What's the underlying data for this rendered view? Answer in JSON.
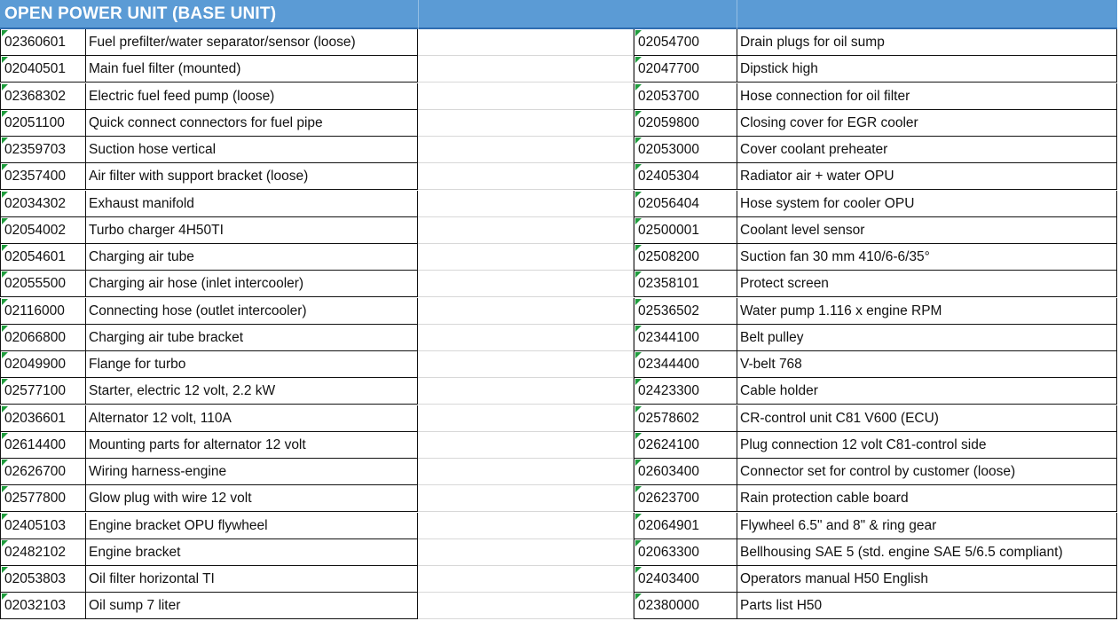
{
  "header": {
    "title": "OPEN POWER UNIT (BASE UNIT)"
  },
  "colors": {
    "header_bg": "#5b9bd5",
    "header_text": "#ffffff",
    "marker": "#1e9c3c"
  },
  "left_rows": [
    {
      "code": "02360601",
      "desc": "Fuel prefilter/water separator/sensor (loose)"
    },
    {
      "code": "02040501",
      "desc": "Main fuel filter (mounted)"
    },
    {
      "code": "02368302",
      "desc": "Electric fuel feed pump (loose)"
    },
    {
      "code": "02051100",
      "desc": "Quick connect connectors for fuel pipe"
    },
    {
      "code": "02359703",
      "desc": "Suction hose vertical"
    },
    {
      "code": "02357400",
      "desc": "Air filter with support bracket (loose)"
    },
    {
      "code": "02034302",
      "desc": "Exhaust manifold"
    },
    {
      "code": "02054002",
      "desc": "Turbo charger 4H50TI"
    },
    {
      "code": "02054601",
      "desc": "Charging air tube"
    },
    {
      "code": "02055500",
      "desc": "Charging air hose (inlet intercooler)"
    },
    {
      "code": "02116000",
      "desc": "Connecting hose (outlet intercooler)"
    },
    {
      "code": "02066800",
      "desc": "Charging air tube bracket"
    },
    {
      "code": "02049900",
      "desc": "Flange for turbo"
    },
    {
      "code": "02577100",
      "desc": "Starter, electric 12 volt, 2.2 kW"
    },
    {
      "code": "02036601",
      "desc": "Alternator 12 volt, 110A"
    },
    {
      "code": "02614400",
      "desc": "Mounting parts for alternator 12 volt"
    },
    {
      "code": "02626700",
      "desc": "Wiring harness-engine"
    },
    {
      "code": "02577800",
      "desc": "Glow plug with wire 12 volt"
    },
    {
      "code": "02405103",
      "desc": "Engine bracket OPU flywheel"
    },
    {
      "code": "02482102",
      "desc": "Engine bracket"
    },
    {
      "code": "02053803",
      "desc": "Oil filter horizontal TI"
    },
    {
      "code": "02032103",
      "desc": "Oil sump 7 liter"
    }
  ],
  "right_rows": [
    {
      "code": "02054700",
      "desc": "Drain plugs for oil sump"
    },
    {
      "code": "02047700",
      "desc": "Dipstick high"
    },
    {
      "code": "02053700",
      "desc": "Hose connection for oil filter"
    },
    {
      "code": "02059800",
      "desc": "Closing cover for EGR cooler"
    },
    {
      "code": "02053000",
      "desc": "Cover coolant preheater"
    },
    {
      "code": "02405304",
      "desc": "Radiator air + water OPU"
    },
    {
      "code": "02056404",
      "desc": "Hose system for cooler OPU"
    },
    {
      "code": "02500001",
      "desc": "Coolant level sensor"
    },
    {
      "code": "02508200",
      "desc": "Suction fan 30 mm 410/6-6/35°"
    },
    {
      "code": "02358101",
      "desc": "Protect screen"
    },
    {
      "code": "02536502",
      "desc": "Water pump 1.116 x engine RPM"
    },
    {
      "code": "02344100",
      "desc": "Belt pulley"
    },
    {
      "code": "02344400",
      "desc": "V-belt 768"
    },
    {
      "code": "02423300",
      "desc": "Cable holder"
    },
    {
      "code": "02578602",
      "desc": "CR-control unit C81 V600 (ECU)"
    },
    {
      "code": "02624100",
      "desc": "Plug connection 12 volt C81-control side"
    },
    {
      "code": "02603400",
      "desc": "Connector set for control by customer (loose)"
    },
    {
      "code": "02623700",
      "desc": "Rain protection cable board"
    },
    {
      "code": "02064901",
      "desc": "Flywheel 6.5\" and 8\" & ring gear"
    },
    {
      "code": "02063300",
      "desc": "Bellhousing SAE 5 (std. engine SAE 5/6.5 compliant)"
    },
    {
      "code": "02403400",
      "desc": "Operators manual H50 English"
    },
    {
      "code": "02380000",
      "desc": "Parts list H50"
    }
  ]
}
